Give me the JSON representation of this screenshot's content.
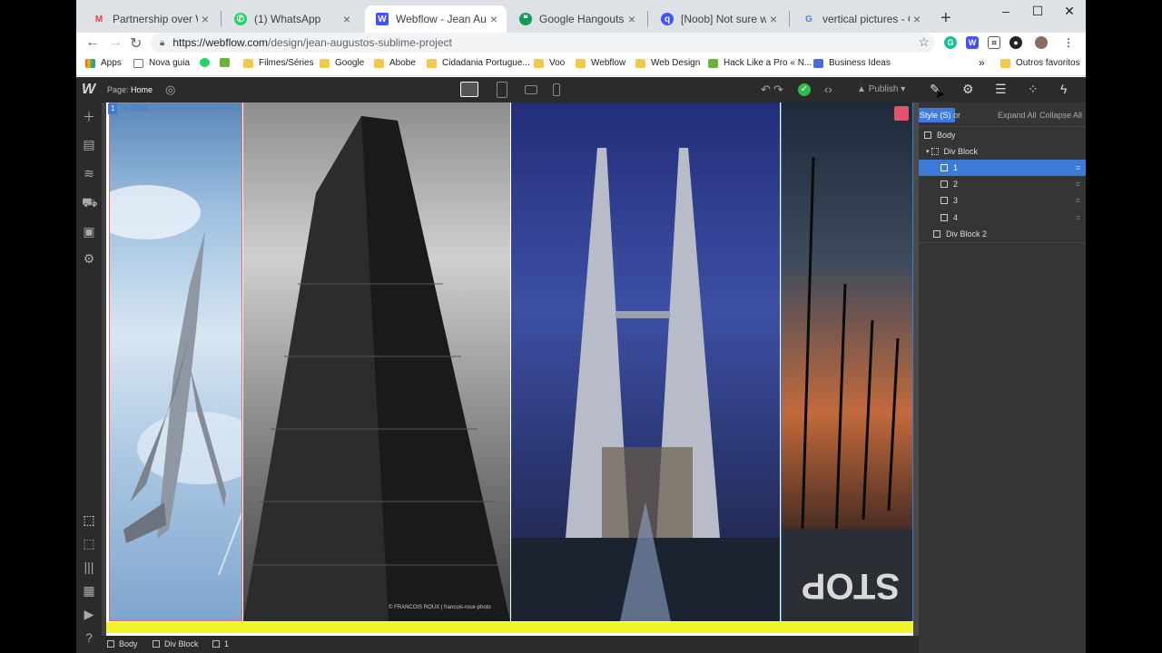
{
  "browser": {
    "tabs": [
      {
        "title": "Partnership over Webflow",
        "icon": "gmail-icon"
      },
      {
        "title": "(1) WhatsApp",
        "icon": "whatsapp-icon"
      },
      {
        "title": "Webflow - Jean Augusto's",
        "icon": "webflow-icon",
        "active": true
      },
      {
        "title": "Google Hangouts",
        "icon": "hangouts-icon"
      },
      {
        "title": "[Noob] Not sure where to",
        "icon": "forum-icon"
      },
      {
        "title": "vertical pictures - Google",
        "icon": "google-icon"
      }
    ],
    "new_tab": "+",
    "url_host": "https://webflow.com",
    "url_path": "/design/jean-augustos-sublime-project",
    "bookmarks": [
      "Apps",
      "Nova guia",
      "",
      "",
      "Filmes/Séries",
      "Google",
      "Abobe",
      "Cidadania Portugue...",
      "Voo",
      "Webflow",
      "Web Design",
      "Hack Like a Pro « N...",
      "Business Ideas"
    ],
    "overflow": "»",
    "other_bookmarks": "Outros favoritos"
  },
  "webflow": {
    "logo": "W",
    "page_label": "Page:",
    "page_name": "Home",
    "publish_label": "Publish",
    "tooltip": "Style (S)",
    "navigator_suffix": "or",
    "expand_all": "Expand All",
    "collapse_all": "Collapse All",
    "tree": [
      {
        "label": "Body",
        "indent": 0
      },
      {
        "label": "Div Block",
        "indent": 1
      },
      {
        "label": "1",
        "indent": 2,
        "selected": true
      },
      {
        "label": "2",
        "indent": 2
      },
      {
        "label": "3",
        "indent": 2
      },
      {
        "label": "4",
        "indent": 2
      },
      {
        "label": "Div Block 2",
        "indent": 1
      }
    ],
    "selected_badge": "1",
    "selected_tag": "iv Block",
    "photo_credit": "© FRANCOIS ROUX  |  francois-roux-photo",
    "breadcrumb": [
      "Body",
      "Div Block",
      "1"
    ]
  },
  "colors": {
    "accent": "#3b7ad5",
    "publish_ok": "#2ebc4f",
    "yellow_block": "#f2f52a"
  }
}
